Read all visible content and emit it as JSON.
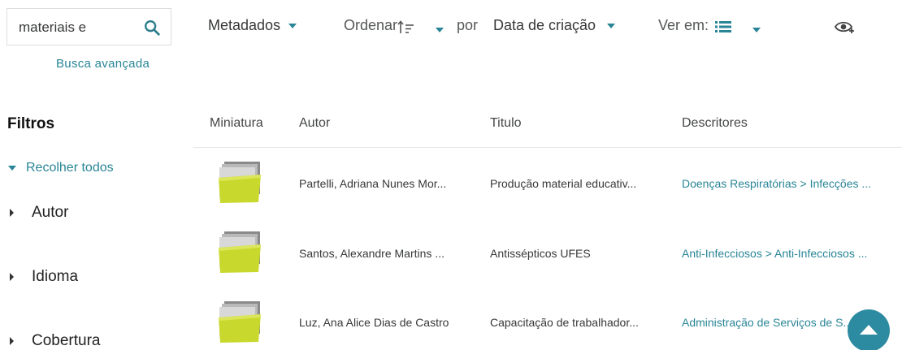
{
  "search": {
    "value": "materiais e",
    "advanced_link": "Busca avançada"
  },
  "toolbar": {
    "metadata_label": "Metadados",
    "sort_label": "Ordenar",
    "by_label": "por",
    "sort_field": "Data de criação",
    "view_label": "Ver em:"
  },
  "filters": {
    "title": "Filtros",
    "collapse_all": "Recolher todos",
    "items": [
      {
        "label": "Autor"
      },
      {
        "label": "Idioma"
      },
      {
        "label": "Cobertura"
      }
    ]
  },
  "table": {
    "columns": [
      "Miniatura",
      "Autor",
      "Titulo",
      "Descritores"
    ],
    "rows": [
      {
        "author": "Partelli, Adriana Nunes Mor...",
        "title": "Produção material educativ...",
        "descriptors": "Doenças Respiratórias > Infecções ..."
      },
      {
        "author": "Santos, Alexandre Martins ...",
        "title": "Antissépticos UFES",
        "descriptors": "Anti-Infecciosos > Anti-Infecciosos ..."
      },
      {
        "author": "Luz, Ana Alice Dias de Castro",
        "title": "Capacitação de trabalhador...",
        "descriptors": "Administração de Serviços de S..."
      }
    ]
  },
  "colors": {
    "accent": "#298596",
    "fab": "#2c8ba0",
    "folder": "#c9d82c"
  },
  "icons": {
    "search": "search-icon",
    "sort": "sort-ascending-icon",
    "view": "list-view-icon",
    "eye": "eye-plus-icon",
    "thumbnail": "folder-icon",
    "back_to_top": "arrow-up-icon"
  }
}
